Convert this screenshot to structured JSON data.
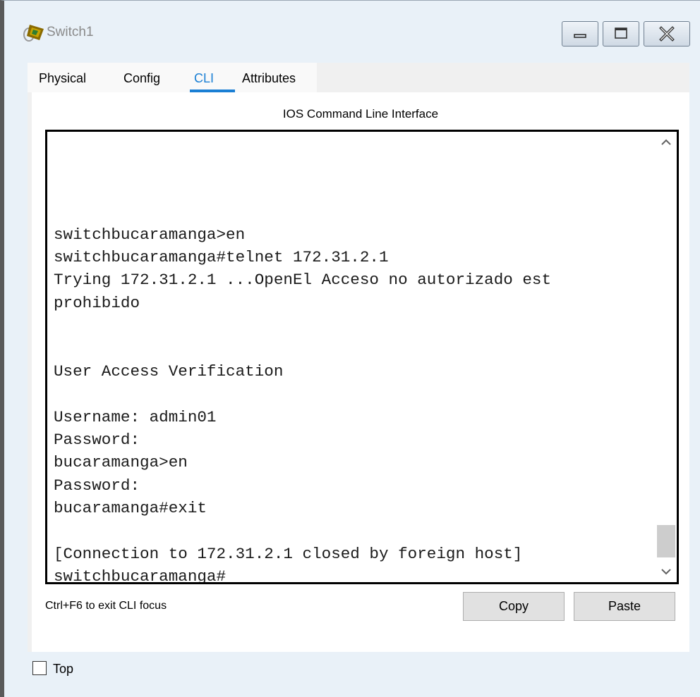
{
  "window": {
    "title": "Switch1",
    "icon": "packet-tracer-switch-icon"
  },
  "tabs": [
    {
      "label": "Physical",
      "active": false
    },
    {
      "label": "Config",
      "active": false
    },
    {
      "label": "CLI",
      "active": true
    },
    {
      "label": "Attributes",
      "active": false
    }
  ],
  "cli": {
    "heading": "IOS Command Line Interface",
    "lines": [
      "",
      "",
      "",
      "",
      "switchbucaramanga>en",
      "switchbucaramanga#telnet 172.31.2.1",
      "Trying 172.31.2.1 ...OpenEl Acceso no autorizado est",
      "prohibido",
      "",
      "",
      "User Access Verification",
      "",
      "Username: admin01",
      "Password:",
      "bucaramanga>en",
      "Password:",
      "bucaramanga#exit",
      "",
      "[Connection to 172.31.2.1 closed by foreign host]",
      "switchbucaramanga#"
    ],
    "hint": "Ctrl+F6 to exit CLI focus",
    "copy_label": "Copy",
    "paste_label": "Paste"
  },
  "footer": {
    "top_label": "Top",
    "top_checked": false
  },
  "colors": {
    "accent": "#1a7fd4",
    "window_bg": "#e9f1f8",
    "terminal_text": "#1a1a1a"
  }
}
